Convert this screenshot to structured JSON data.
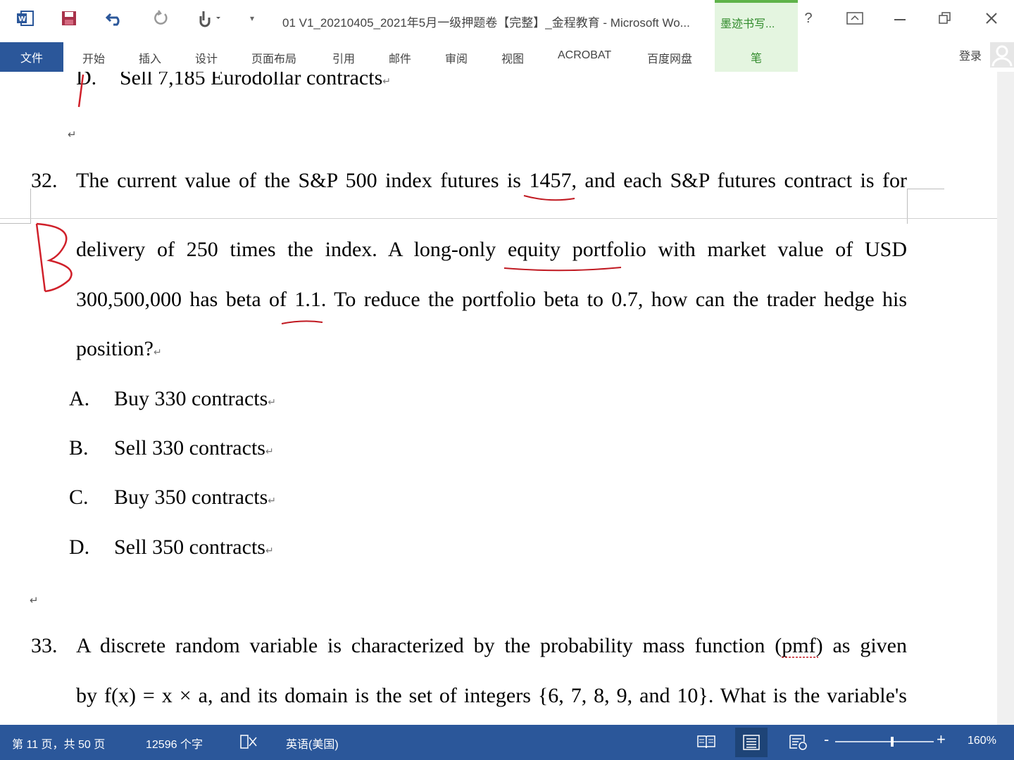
{
  "window": {
    "title": "01 V1_20210405_2021年5月一级押题卷【完整】_金程教育 - Microsoft Wo...",
    "ink_tab_label": "墨迹书写...",
    "help_icon": "question-icon",
    "brand_color": "#2b579a",
    "ink_color": "#5fb34a"
  },
  "ribbon": {
    "file": "文件",
    "tabs": [
      "开始",
      "插入",
      "设计",
      "页面布局",
      "引用",
      "邮件",
      "审阅",
      "视图",
      "ACROBAT",
      "百度网盘"
    ],
    "pen": "笔",
    "login": "登录"
  },
  "document": {
    "prev_option": {
      "letter": "D.",
      "text": "Sell 7,185 Eurodollar contracts"
    },
    "q32": {
      "number": "32.",
      "line1": "The current value of the S&P 500 index futures is 1457, and each S&P futures contract is for",
      "line2": "delivery of 250 times the index. A long-only equity portfolio with market value of USD",
      "line3": "300,500,000 has beta of 1.1. To reduce the portfolio beta to 0.7, how can the trader hedge his",
      "line4": "position?",
      "options": [
        {
          "letter": "A.",
          "text": "Buy 330 contracts"
        },
        {
          "letter": "B.",
          "text": "Sell 330 contracts"
        },
        {
          "letter": "C.",
          "text": "Buy 350 contracts"
        },
        {
          "letter": "D.",
          "text": "Sell 350 contracts"
        }
      ],
      "handwritten_answer": "B"
    },
    "q33": {
      "number": "33.",
      "line1": "A discrete random variable is characterized by the probability mass function (pmf) as given",
      "line2": "by f(x)  =  x × a, and its domain is the set of integers {6, 7, 8, 9, and 10}. What is the variable's"
    },
    "para_mark": "↵",
    "annotation_color": "#d0202a"
  },
  "status": {
    "page": "第 11 页，共 50 页",
    "words": "12596 个字",
    "language": "英语(美国)",
    "zoom": "160%",
    "zoom_level_fraction": 0.58
  }
}
